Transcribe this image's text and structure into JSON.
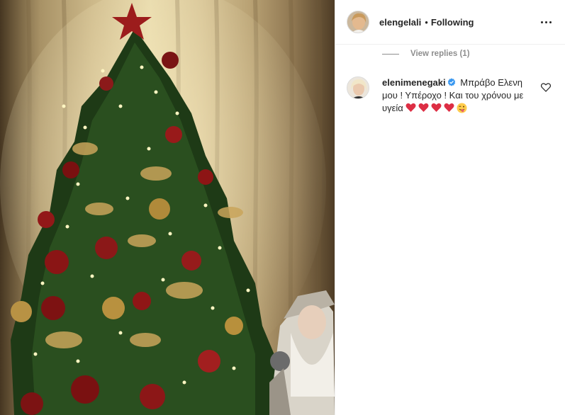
{
  "header": {
    "username": "elengelali",
    "separator": "•",
    "follow_label": "Following",
    "more_icon": "more-horizontal-icon"
  },
  "replies": {
    "label": "View replies (1)"
  },
  "comment": {
    "username": "elenimenegaki",
    "verified": true,
    "text": "Μπράβο Ελενη μου ! Υπέροχο ! Και του χρόνου με υγεία",
    "emojis": [
      "red-heart",
      "red-heart",
      "red-heart",
      "red-heart",
      "winking-face-with-tongue"
    ],
    "like_icon": "heart-outline-icon"
  },
  "photo": {
    "subject": "christmas-tree-photo"
  },
  "colors": {
    "text": "#262626",
    "muted": "#8e8e8e",
    "verified_blue": "#3897f0",
    "heart_red": "#dd2e44",
    "border": "#efefef"
  }
}
